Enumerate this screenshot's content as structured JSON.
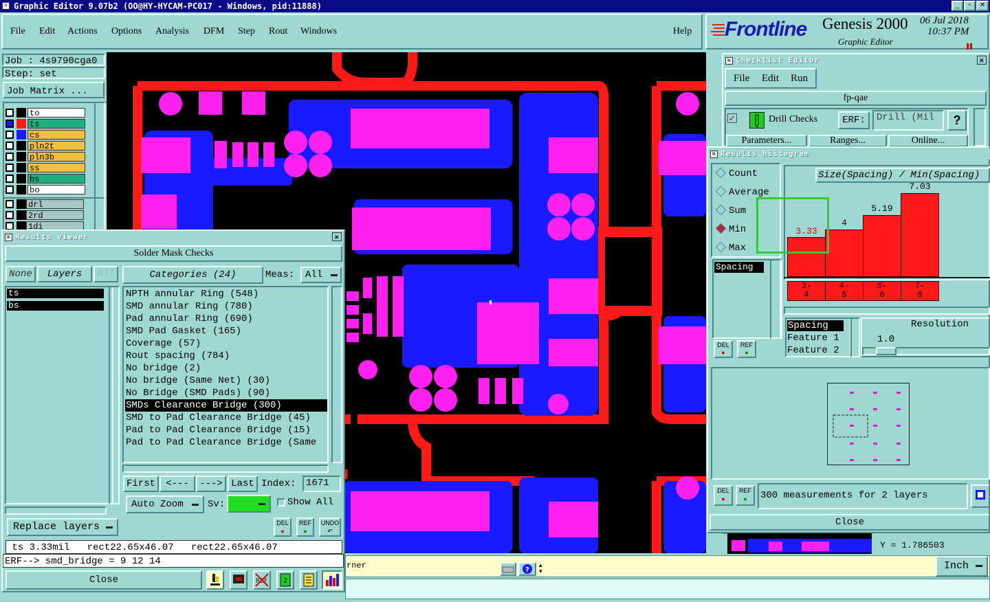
{
  "window": {
    "title": "Graphic Editor 9.07b2 (OO@HY-HYCAM-PC017 - Windows, pid:11888)"
  },
  "menu": [
    "File",
    "Edit",
    "Actions",
    "Options",
    "Analysis",
    "DFM",
    "Step",
    "Rout",
    "Windows"
  ],
  "help": "Help",
  "brand": {
    "logo": "Frontline",
    "product": "Genesis 2000",
    "subtitle": "Graphic Editor",
    "date": "06 Jul 2018",
    "time": "10:37 PM"
  },
  "job": {
    "job": "Job : 4s9790cga0",
    "step": "Step: set",
    "matrix": "Job Matrix ..."
  },
  "layers": [
    {
      "name": "to",
      "color": "#ffffff",
      "box": "#000000"
    },
    {
      "name": "ts",
      "color": "#20b080",
      "box": "#ff1a1a",
      "sel": true
    },
    {
      "name": "cs",
      "color": "#f0c040",
      "box": "#1a1aff"
    },
    {
      "name": "pln2t",
      "color": "#f0c040",
      "box": "#000000"
    },
    {
      "name": "pln3b",
      "color": "#f0c040",
      "box": "#000000"
    },
    {
      "name": "ss",
      "color": "#f0c040",
      "box": "#000000"
    },
    {
      "name": "bs",
      "color": "#20b080",
      "box": "#000000"
    },
    {
      "name": "bo",
      "color": "#ffffff",
      "box": "#000000"
    },
    {
      "name": "drl",
      "color": "#a8c8c8",
      "box": "#000000"
    },
    {
      "name": "2rd",
      "color": "#a8c8c8",
      "box": "#000000"
    },
    {
      "name": "1di",
      "color": "#a8c8c8",
      "box": "#000000"
    }
  ],
  "results": {
    "title": "Results viewer",
    "header": "Solder Mask Checks",
    "none": "None",
    "layers_btn": "Layers",
    "all": "All",
    "categories_btn": "Categories (24)",
    "meas_label": "Meas:",
    "meas_value": "All",
    "layer_list": [
      "ts",
      "bs"
    ],
    "categories": [
      "NPTH annular Ring (548)",
      "SMD annular Ring (780)",
      "Pad annular Ring (690)",
      "SMD Pad Gasket (165)",
      "Coverage (57)",
      "Rout spacing (784)",
      "No bridge (2)",
      "No bridge (Same Net) (30)",
      "No Bridge (SMD Pads) (90)",
      "SMDs Clearance Bridge (300)",
      "SMD to Pad Clearance Bridge (45)",
      "Pad to Pad Clearance Bridge (15)",
      "Pad to Pad Clearance Bridge (Same"
    ],
    "selected_index": 9,
    "nav": [
      "First",
      "<---",
      "--->",
      "Last"
    ],
    "index_label": "Index:",
    "index_value": "1671",
    "auto_zoom": "Auto Zoom",
    "sv": "Sv:",
    "show_all": "Show All",
    "replace": "Replace layers",
    "status": " ts 3.33mil   rect22.65x46.07   rect22.65x46.07",
    "erf": "ERF--> smd_bridge = 9 12 14",
    "close": "Close",
    "del": "DEL",
    "ref": "REF",
    "undo": "UNDO"
  },
  "checklist": {
    "title": "Checklist Editor",
    "menu": [
      "File",
      "Edit",
      "Run"
    ],
    "name": "fp-qae",
    "check": "Drill Checks",
    "erf": "ERF:",
    "erf_value": "Drill (Mil",
    "params": "Parameters...",
    "ranges": "Ranges...",
    "online": "Online..."
  },
  "histogram": {
    "title": "Results histogram",
    "modes": [
      "Count",
      "Average",
      "Sum",
      "Min",
      "Max"
    ],
    "selected_mode": "Min",
    "axis_title": "Size(Spacing) / Min(Spacing)",
    "chart_data": {
      "type": "bar",
      "categories": [
        "3-4",
        "4-5",
        "5-6",
        "7-8"
      ],
      "values": [
        3.33,
        4,
        5.19,
        7.03
      ],
      "labels": [
        "3.33",
        "4",
        "5.19",
        "7.03"
      ],
      "title": "Size(Spacing) / Min(Spacing)"
    },
    "spacing": "Spacing",
    "features": [
      "Spacing",
      "Feature 1",
      "Feature 2"
    ],
    "resolution_label": "Resolution",
    "resolution": "1.0",
    "summary": "300 measurements for 2 layers",
    "close": "Close"
  },
  "bottom": {
    "hint": "rner",
    "units": "Inch",
    "coord": "Y = 1.786503"
  },
  "colors": {
    "bg": "#9fd8d3",
    "canvas": "#000000",
    "red": "#ff1a1a",
    "blue": "#1a1aff",
    "magenta": "#ff22ee",
    "selected": "#000000"
  }
}
